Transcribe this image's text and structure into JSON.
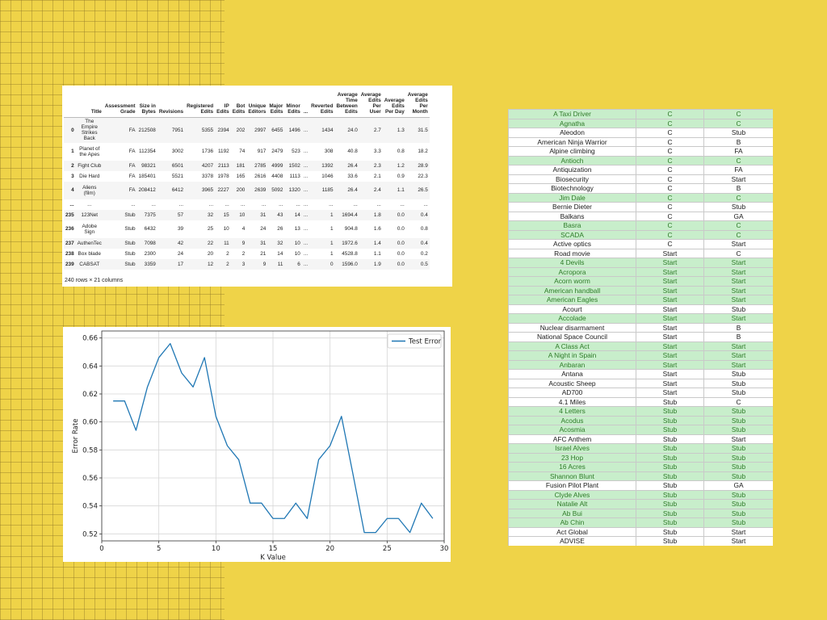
{
  "dataframe": {
    "columns": [
      "",
      "Title",
      "Assessment\nGrade",
      "Size in\nBytes",
      "Revisions",
      "Registered\nEdits",
      "IP\nEdits",
      "Bot\nEdits",
      "Unique\nEditors",
      "Major\nEdits",
      "Minor\nEdits",
      "...",
      "Reverted\nEdits",
      "Average\nTime\nBetween\nEdits",
      "Average\nEdits\nPer\nUser",
      "Average\nEdits\nPer Day",
      "Average\nEdits\nPer\nMonth"
    ],
    "rows": [
      [
        "0",
        "The\nEmpire\nStrikes\nBack",
        "FA",
        "212508",
        "7951",
        "5355",
        "2394",
        "202",
        "2997",
        "6455",
        "1496",
        "...",
        "1434",
        "24.0",
        "2.7",
        "1.3",
        "31.5"
      ],
      [
        "1",
        "Planet of\nthe Apes",
        "FA",
        "112354",
        "3002",
        "1736",
        "1192",
        "74",
        "917",
        "2479",
        "523",
        "...",
        "308",
        "40.8",
        "3.3",
        "0.8",
        "18.2"
      ],
      [
        "2",
        "Fight Club",
        "FA",
        "98321",
        "6501",
        "4207",
        "2113",
        "181",
        "2785",
        "4999",
        "1502",
        "...",
        "1392",
        "26.4",
        "2.3",
        "1.2",
        "28.9"
      ],
      [
        "3",
        "Die Hard",
        "FA",
        "185401",
        "5521",
        "3378",
        "1978",
        "165",
        "2616",
        "4408",
        "1113",
        "...",
        "1046",
        "33.6",
        "2.1",
        "0.9",
        "22.3"
      ],
      [
        "4",
        "Aliens\n(film)",
        "FA",
        "208412",
        "6412",
        "3965",
        "2227",
        "200",
        "2639",
        "5092",
        "1320",
        "...",
        "1185",
        "26.4",
        "2.4",
        "1.1",
        "26.5"
      ],
      [
        "...",
        "...",
        "...",
        "...",
        "...",
        "...",
        "...",
        "...",
        "...",
        "...",
        "...",
        "...",
        "...",
        "...",
        "...",
        "...",
        "..."
      ],
      [
        "235",
        "123Net",
        "Stub",
        "7375",
        "57",
        "32",
        "15",
        "10",
        "31",
        "43",
        "14",
        "...",
        "1",
        "1694.4",
        "1.8",
        "0.0",
        "0.4"
      ],
      [
        "236",
        "Adobe\nSign",
        "Stub",
        "6432",
        "39",
        "25",
        "10",
        "4",
        "24",
        "26",
        "13",
        "...",
        "1",
        "904.8",
        "1.6",
        "0.0",
        "0.8"
      ],
      [
        "237",
        "AuthenTec",
        "Stub",
        "7098",
        "42",
        "22",
        "11",
        "9",
        "31",
        "32",
        "10",
        "...",
        "1",
        "1972.6",
        "1.4",
        "0.0",
        "0.4"
      ],
      [
        "238",
        "Box blade",
        "Stub",
        "2300",
        "24",
        "20",
        "2",
        "2",
        "21",
        "14",
        "10",
        "...",
        "1",
        "4528.8",
        "1.1",
        "0.0",
        "0.2"
      ],
      [
        "239",
        "CABSAT",
        "Stub",
        "3359",
        "17",
        "12",
        "2",
        "3",
        "9",
        "11",
        "6",
        "...",
        "0",
        "1596.0",
        "1.9",
        "0.0",
        "0.5"
      ]
    ],
    "footer": "240 rows × 21 columns"
  },
  "chart_data": {
    "type": "line",
    "title": "",
    "xlabel": "K Value",
    "ylabel": "Error Rate",
    "xlim": [
      0,
      30
    ],
    "ylim": [
      0.515,
      0.665
    ],
    "xticks": [
      0,
      5,
      10,
      15,
      20,
      25,
      30
    ],
    "yticks": [
      0.52,
      0.54,
      0.56,
      0.58,
      0.6,
      0.62,
      0.64,
      0.66
    ],
    "grid": true,
    "legend": "top-right",
    "series": [
      {
        "name": "Test Error",
        "color": "#1f77b4",
        "x": [
          1,
          2,
          3,
          4,
          5,
          6,
          7,
          8,
          9,
          10,
          11,
          12,
          13,
          14,
          15,
          16,
          17,
          18,
          19,
          20,
          21,
          22,
          23,
          24,
          25,
          26,
          27,
          28,
          29
        ],
        "y": [
          0.615,
          0.615,
          0.594,
          0.625,
          0.646,
          0.656,
          0.635,
          0.625,
          0.646,
          0.604,
          0.583,
          0.573,
          0.542,
          0.542,
          0.531,
          0.531,
          0.542,
          0.531,
          0.573,
          0.583,
          0.604,
          0.563,
          0.521,
          0.521,
          0.531,
          0.531,
          0.521,
          0.542,
          0.531
        ]
      }
    ]
  },
  "ratings": {
    "rows": [
      {
        "title": "A Taxi Driver",
        "a": "C",
        "b": "C",
        "match": true
      },
      {
        "title": "Agnatha",
        "a": "C",
        "b": "C",
        "match": true
      },
      {
        "title": "Aleodon",
        "a": "C",
        "b": "Stub",
        "match": false
      },
      {
        "title": "American Ninja Warrior",
        "a": "C",
        "b": "B",
        "match": false
      },
      {
        "title": "Alpine climbing",
        "a": "C",
        "b": "FA",
        "match": false
      },
      {
        "title": "Antioch",
        "a": "C",
        "b": "C",
        "match": true
      },
      {
        "title": "Antiquization",
        "a": "C",
        "b": "FA",
        "match": false
      },
      {
        "title": "Biosecurity",
        "a": "C",
        "b": "Start",
        "match": false
      },
      {
        "title": "Biotechnology",
        "a": "C",
        "b": "B",
        "match": false
      },
      {
        "title": "Jim Dale",
        "a": "C",
        "b": "C",
        "match": true
      },
      {
        "title": "Bernie Dieter",
        "a": "C",
        "b": "Stub",
        "match": false
      },
      {
        "title": "Balkans",
        "a": "C",
        "b": "GA",
        "match": false
      },
      {
        "title": "Basra",
        "a": "C",
        "b": "C",
        "match": true
      },
      {
        "title": "SCADA",
        "a": "C",
        "b": "C",
        "match": true
      },
      {
        "title": "Active optics",
        "a": "C",
        "b": "Start",
        "match": false
      },
      {
        "title": "Road movie",
        "a": "Start",
        "b": "C",
        "match": false
      },
      {
        "title": "4 Devils",
        "a": "Start",
        "b": "Start",
        "match": true
      },
      {
        "title": "Acropora",
        "a": "Start",
        "b": "Start",
        "match": true
      },
      {
        "title": "Acorn worm",
        "a": "Start",
        "b": "Start",
        "match": true
      },
      {
        "title": "American handball",
        "a": "Start",
        "b": "Start",
        "match": true
      },
      {
        "title": "American Eagles",
        "a": "Start",
        "b": "Start",
        "match": true
      },
      {
        "title": "Acourt",
        "a": "Start",
        "b": "Stub",
        "match": false
      },
      {
        "title": "Accolade",
        "a": "Start",
        "b": "Start",
        "match": true
      },
      {
        "title": "Nuclear disarmament",
        "a": "Start",
        "b": "B",
        "match": false
      },
      {
        "title": "National Space Council",
        "a": "Start",
        "b": "B",
        "match": false
      },
      {
        "title": "A Class Act",
        "a": "Start",
        "b": "Start",
        "match": true
      },
      {
        "title": "A Night in Spain",
        "a": "Start",
        "b": "Start",
        "match": true
      },
      {
        "title": "Anbaran",
        "a": "Start",
        "b": "Start",
        "match": true
      },
      {
        "title": "Antana",
        "a": "Start",
        "b": "Stub",
        "match": false
      },
      {
        "title": "Acoustic Sheep",
        "a": "Start",
        "b": "Stub",
        "match": false
      },
      {
        "title": "AD700",
        "a": "Start",
        "b": "Stub",
        "match": false
      },
      {
        "title": "4.1 Miles",
        "a": "Stub",
        "b": "C",
        "match": false
      },
      {
        "title": "4 Letters",
        "a": "Stub",
        "b": "Stub",
        "match": true
      },
      {
        "title": "Acodus",
        "a": "Stub",
        "b": "Stub",
        "match": true
      },
      {
        "title": "Acosmia",
        "a": "Stub",
        "b": "Stub",
        "match": true
      },
      {
        "title": "AFC Anthem",
        "a": "Stub",
        "b": "Start",
        "match": false
      },
      {
        "title": "Israel Alves",
        "a": "Stub",
        "b": "Stub",
        "match": true
      },
      {
        "title": "23 Hop",
        "a": "Stub",
        "b": "Stub",
        "match": true
      },
      {
        "title": "16 Acres",
        "a": "Stub",
        "b": "Stub",
        "match": true
      },
      {
        "title": "Shannon Blunt",
        "a": "Stub",
        "b": "Stub",
        "match": true
      },
      {
        "title": "Fusion Pilot Plant",
        "a": "Stub",
        "b": "GA",
        "match": false
      },
      {
        "title": "Clyde Alves",
        "a": "Stub",
        "b": "Stub",
        "match": true
      },
      {
        "title": "Natalie Alt",
        "a": "Stub",
        "b": "Stub",
        "match": true
      },
      {
        "title": "Ab Bui",
        "a": "Stub",
        "b": "Stub",
        "match": true
      },
      {
        "title": "Ab Chin",
        "a": "Stub",
        "b": "Stub",
        "match": true
      },
      {
        "title": "Act Global",
        "a": "Stub",
        "b": "Start",
        "match": false
      },
      {
        "title": "ADVISE",
        "a": "Stub",
        "b": "Start",
        "match": false
      }
    ]
  },
  "colors": {
    "background": "#EFD348",
    "match_fill": "#C8EECB",
    "match_text": "#2E7B28",
    "line": "#1f77b4"
  }
}
